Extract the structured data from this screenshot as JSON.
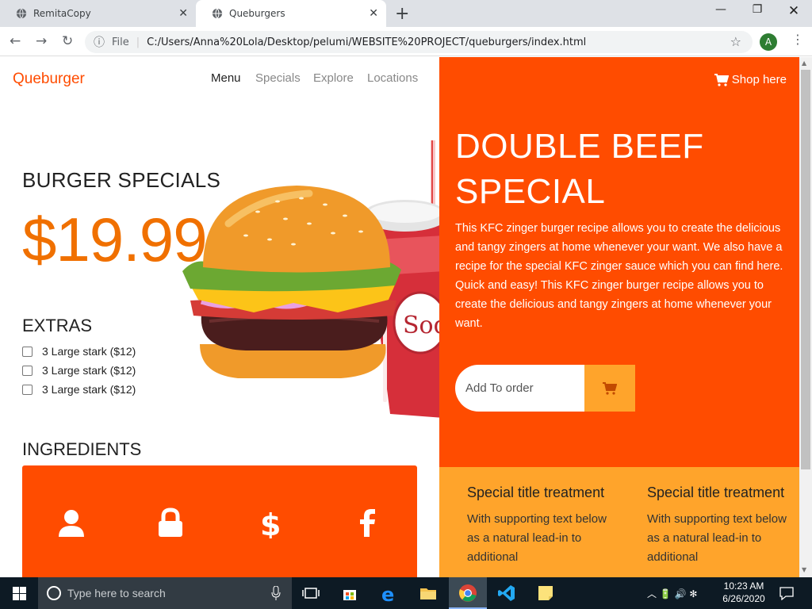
{
  "browser": {
    "tabs": [
      {
        "title": "RemitaCopy",
        "active": false
      },
      {
        "title": "Queburgers",
        "active": true
      }
    ],
    "new_tab_label": "+",
    "address_prefix": "File",
    "url": "C:/Users/Anna%20Lola/Desktop/pelumi/WEBSITE%20PROJECT/queburgers/index.html",
    "profile_initial": "A"
  },
  "site": {
    "brand": "Queburger",
    "nav": [
      "Menu",
      "Specials",
      "Explore",
      "Locations"
    ],
    "shop_label": "Shop here",
    "specials_title": "BURGER SPECIALS",
    "price": "$19.99",
    "extras_title": "EXTRAS",
    "extras": [
      "3 Large stark ($12)",
      "3 Large stark ($12)",
      "3 Large stark ($12)"
    ],
    "ingredients_title": "INGREDIENTS",
    "ingredient_icons": [
      "user-icon",
      "lock-icon",
      "dollar-icon",
      "facebook-icon"
    ],
    "hero_title": "DOUBLE BEEF SPECIAL",
    "hero_description": "This KFC zinger burger recipe allows you to create the delicious and tangy zingers at home whenever your want. We also have a recipe for the special KFC zinger sauce which you can find here. Quick and easy! This KFC zinger burger recipe allows you to create the delicious and tangy zingers at home whenever your want.",
    "order_placeholder": "Add To order",
    "cup_label": "Sod",
    "cards": [
      {
        "title": "Special title treatment",
        "text": "With supporting text below as a natural lead-in to additional"
      },
      {
        "title": "Special title treatment",
        "text": "With supporting text below as a natural lead-in to additional"
      }
    ]
  },
  "taskbar": {
    "search_placeholder": "Type here to search",
    "time": "10:23 AM",
    "date": "6/26/2020"
  },
  "colors": {
    "primary": "#ff4c00",
    "secondary": "#ffa42b",
    "price": "#f07000"
  }
}
